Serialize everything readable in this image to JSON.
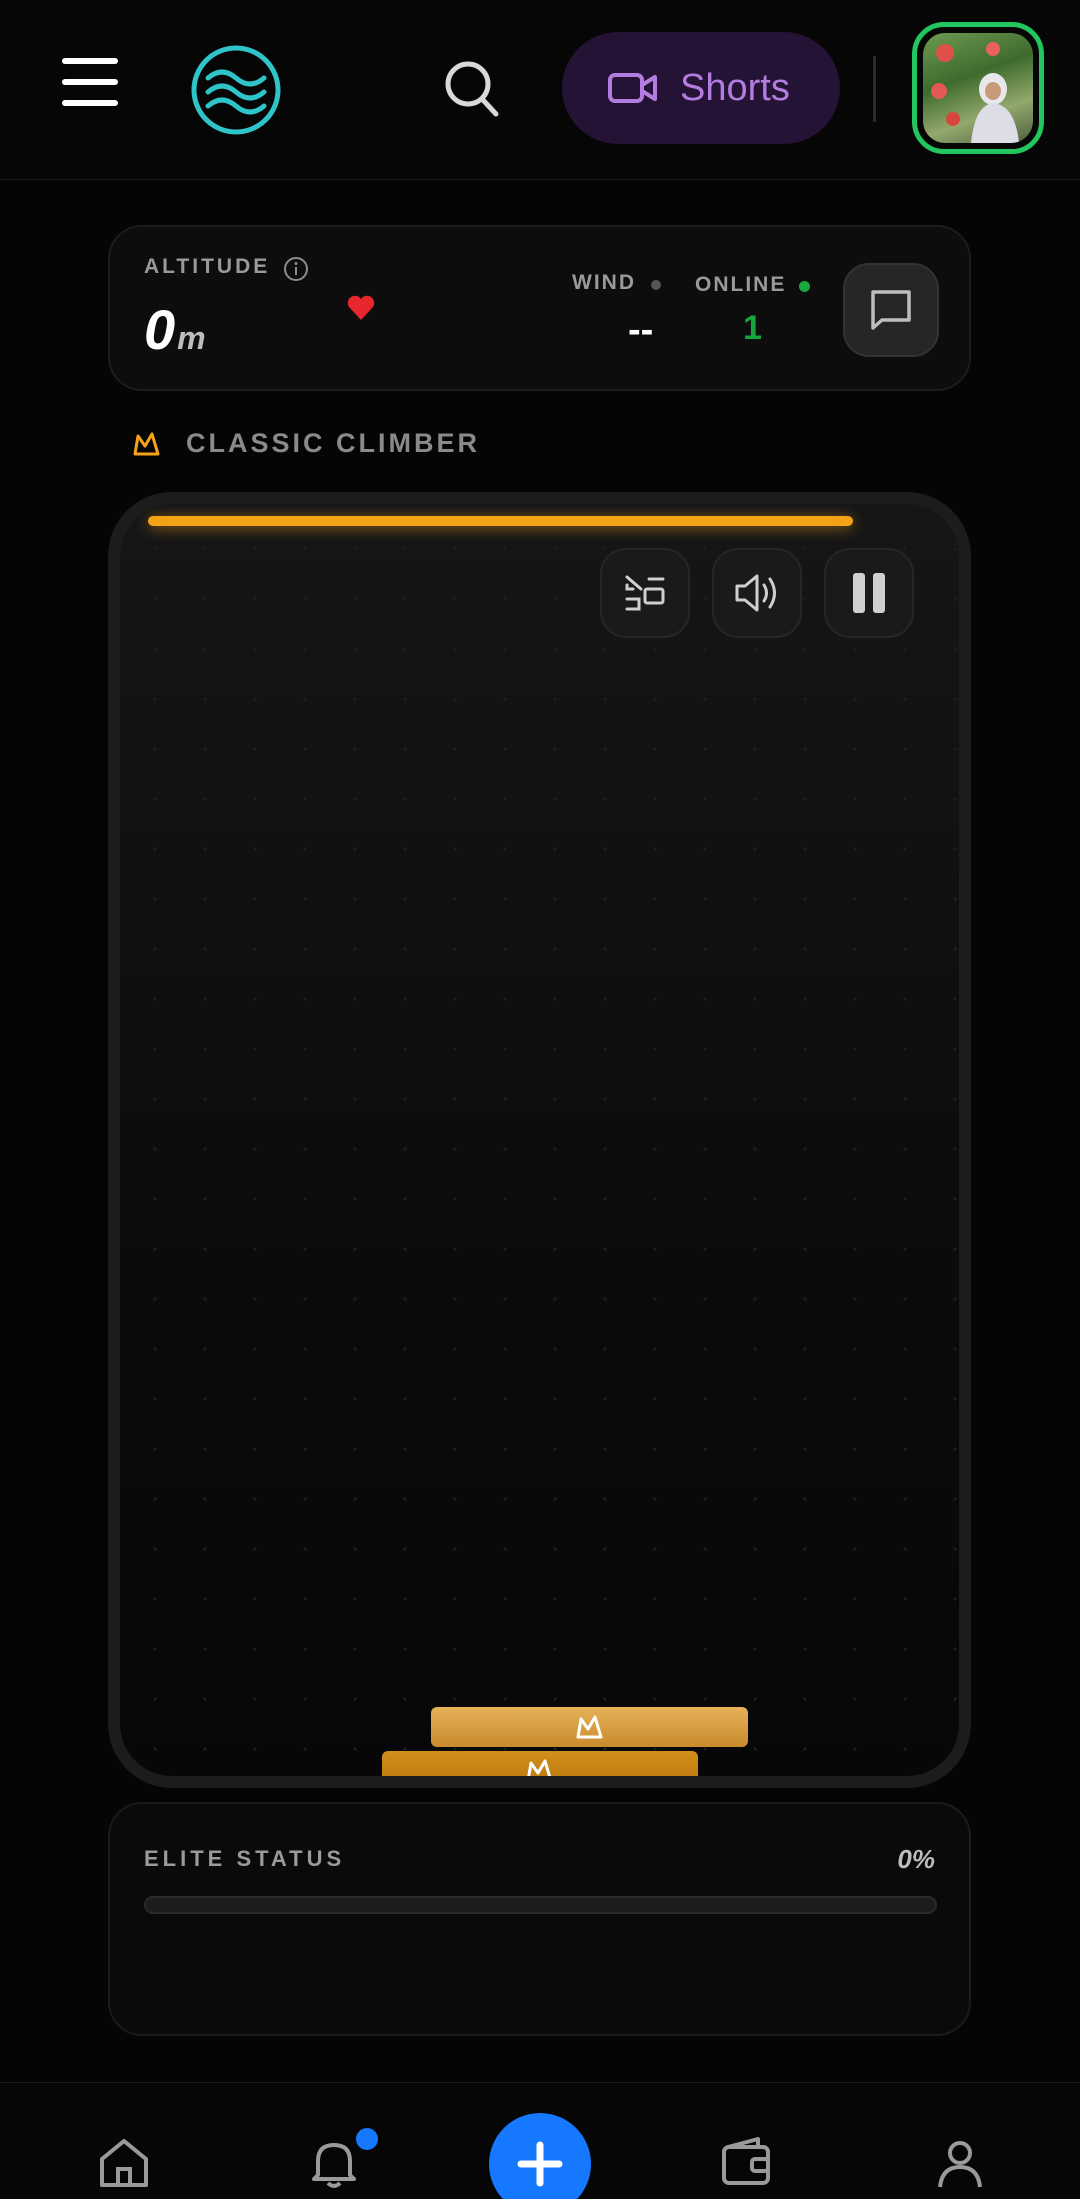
{
  "header": {
    "menu_icon": "hamburger-menu-icon",
    "logo_icon": "waves-logo-icon",
    "search_icon": "search-icon",
    "shorts_label": "Shorts",
    "shorts_icon": "video-camera-icon",
    "avatar_alt": "user-avatar",
    "colors": {
      "shorts_bg": "#241334",
      "shorts_text": "#b27ce0",
      "avatar_ring": "#22c55e",
      "logo": "#2ec4c8"
    }
  },
  "stats": {
    "altitude_label": "ALTITUDE",
    "altitude_value": "0",
    "altitude_unit": "m",
    "wind_label": "WIND",
    "wind_value": "--",
    "online_label": "ONLINE",
    "online_value": "1",
    "chat_icon": "chat-bubble-icon",
    "colors": {
      "heart": "#e8262d",
      "online": "#14a83c"
    }
  },
  "mode": {
    "label": "CLASSIC CLIMBER",
    "icon": "crown-icon",
    "accent": "#f5a316"
  },
  "board": {
    "progress": 0.84,
    "controls": [
      {
        "name": "swap-view-button",
        "icon": "swap-view-icon"
      },
      {
        "name": "sound-button",
        "icon": "speaker-icon"
      },
      {
        "name": "pause-button",
        "icon": "pause-icon"
      }
    ],
    "blocks": [
      {
        "name": "stack-block-top",
        "icon": "crown-icon"
      },
      {
        "name": "stack-block-bottom",
        "icon": "crown-icon"
      }
    ]
  },
  "elite": {
    "label": "ELITE STATUS",
    "percent_label": "0%",
    "percent": 0
  },
  "bottom_nav": {
    "items": [
      {
        "name": "nav-home",
        "icon": "home-icon"
      },
      {
        "name": "nav-notifications",
        "icon": "bell-icon",
        "badge": true
      },
      {
        "name": "nav-create",
        "icon": "plus-icon"
      },
      {
        "name": "nav-wallet",
        "icon": "wallet-icon"
      },
      {
        "name": "nav-profile",
        "icon": "user-icon"
      }
    ],
    "accent": "#1677ff"
  }
}
